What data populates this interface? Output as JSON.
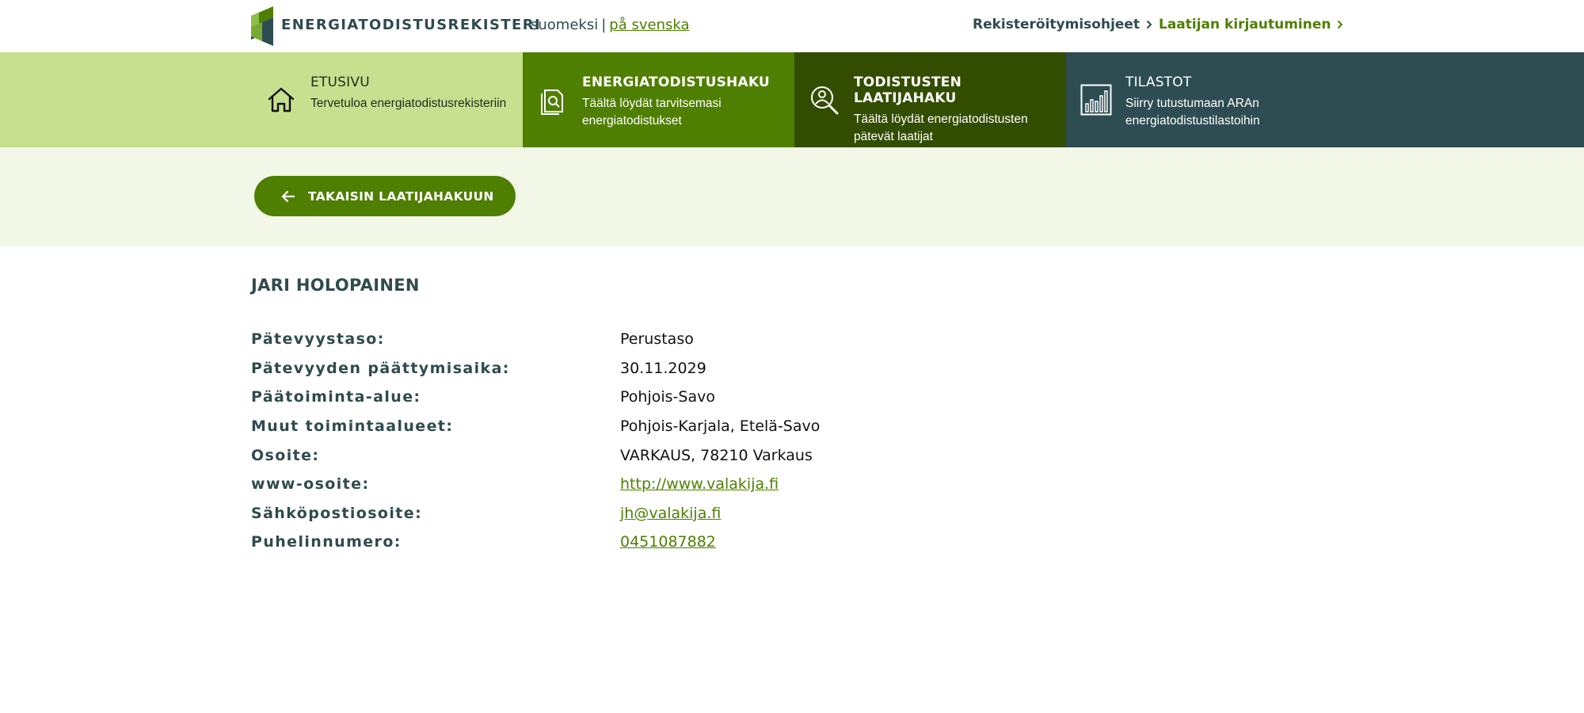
{
  "header": {
    "brand": "ENERGIATODISTUSREKISTERI",
    "lang_current": "suomeksi",
    "lang_separator": "|",
    "lang_other": "på svenska",
    "registration_link": "Rekisteröitymisohjeet",
    "login_link": "Laatijan kirjautuminen",
    "icons": {
      "chevron": "chevron-right-icon",
      "logo": "house-logo-icon"
    }
  },
  "nav": {
    "items": [
      {
        "title": "ETUSIVU",
        "desc": "Tervetuloa energiatodistusrekisteriin",
        "icon": "home-icon"
      },
      {
        "title": "ENERGIATODISTUSHAKU",
        "desc": "Täältä löydät tarvitsemasi energiatodistukset",
        "icon": "document-search-icon"
      },
      {
        "title": "TODISTUSTEN LAATIJAHAKU",
        "desc": "Täältä löydät energiatodistusten pätevät laatijat",
        "icon": "person-search-icon"
      },
      {
        "title": "TILASTOT",
        "desc": "Siirry tutustumaan ARAn energiatodistustilastoihin",
        "icon": "bar-chart-icon"
      }
    ]
  },
  "back_button": {
    "label": "TAKAISIN LAATIJAHAKUUN",
    "icon": "arrow-left-icon"
  },
  "person": {
    "name": "JARI HOLOPAINEN",
    "fields": [
      {
        "label": "Pätevyystaso:",
        "value": "Perustaso"
      },
      {
        "label": "Pätevyyden päättymisaika:",
        "value": "30.11.2029"
      },
      {
        "label": "Päätoiminta-alue:",
        "value": "Pohjois-Savo"
      },
      {
        "label": "Muut toimintaalueet:",
        "value": "Pohjois-Karjala, Etelä-Savo"
      },
      {
        "label": "Osoite:",
        "value": "VARKAUS, 78210 Varkaus"
      },
      {
        "label": "www-osoite:",
        "value": "http://www.valakija.fi"
      },
      {
        "label": "Sähköpostiosoite:",
        "value": "jh@valakija.fi"
      },
      {
        "label": "Puhelinnumero:",
        "value": "0451087882"
      }
    ]
  },
  "colors": {
    "brand_green": "#4f7f00",
    "dark_green": "#334d00",
    "light_green": "#c6e08f",
    "teal": "#2e4d52",
    "band": "#f2f7e7",
    "text_heading": "#2f4b4e"
  }
}
